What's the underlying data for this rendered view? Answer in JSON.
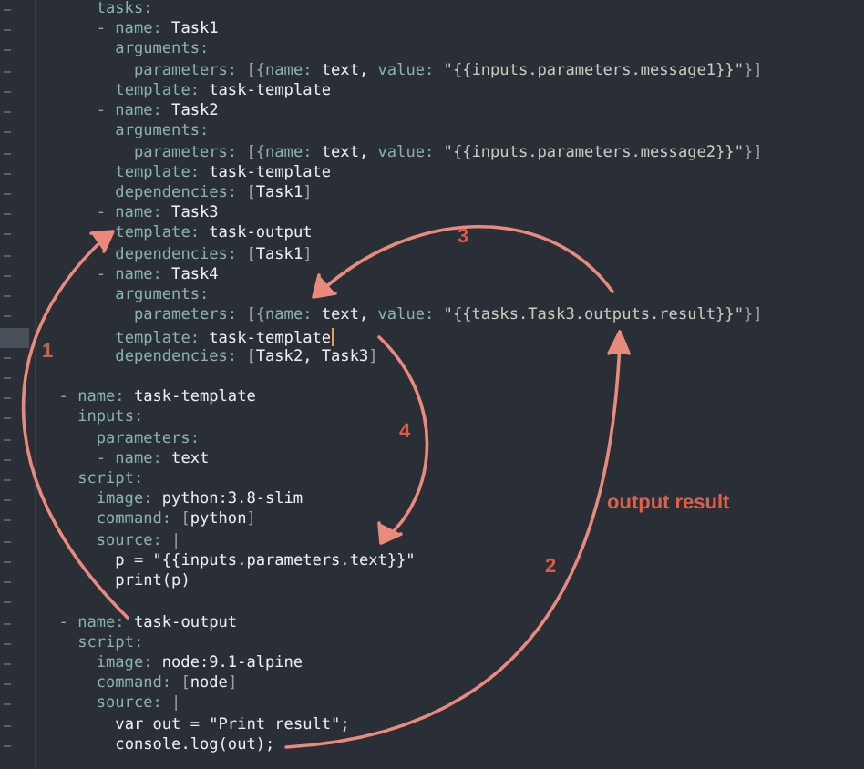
{
  "editor": {
    "lines": [
      {
        "current": false,
        "tokens": [
          {
            "kind": "key",
            "text": "      tasks:"
          }
        ]
      },
      {
        "current": false,
        "tokens": [
          {
            "kind": "key",
            "text": "      - name:"
          },
          {
            "kind": "val",
            "text": " Task1"
          }
        ]
      },
      {
        "current": false,
        "tokens": [
          {
            "kind": "key",
            "text": "        arguments:"
          }
        ]
      },
      {
        "current": false,
        "tokens": [
          {
            "kind": "key",
            "text": "          parameters:"
          },
          {
            "kind": "punct",
            "text": " [{"
          },
          {
            "kind": "key",
            "text": "name:"
          },
          {
            "kind": "val",
            "text": " text,"
          },
          {
            "kind": "key",
            "text": " value:"
          },
          {
            "kind": "str",
            "text": " \"{{inputs.parameters.message1}}\""
          },
          {
            "kind": "punct",
            "text": "}]"
          }
        ]
      },
      {
        "current": false,
        "tokens": [
          {
            "kind": "key",
            "text": "        template:"
          },
          {
            "kind": "val",
            "text": " task-template"
          }
        ]
      },
      {
        "current": false,
        "tokens": [
          {
            "kind": "key",
            "text": "      - name:"
          },
          {
            "kind": "val",
            "text": " Task2"
          }
        ]
      },
      {
        "current": false,
        "tokens": [
          {
            "kind": "key",
            "text": "        arguments:"
          }
        ]
      },
      {
        "current": false,
        "tokens": [
          {
            "kind": "key",
            "text": "          parameters:"
          },
          {
            "kind": "punct",
            "text": " [{"
          },
          {
            "kind": "key",
            "text": "name:"
          },
          {
            "kind": "val",
            "text": " text,"
          },
          {
            "kind": "key",
            "text": " value:"
          },
          {
            "kind": "str",
            "text": " \"{{inputs.parameters.message2}}\""
          },
          {
            "kind": "punct",
            "text": "}]"
          }
        ]
      },
      {
        "current": false,
        "tokens": [
          {
            "kind": "key",
            "text": "        template:"
          },
          {
            "kind": "val",
            "text": " task-template"
          }
        ]
      },
      {
        "current": false,
        "tokens": [
          {
            "kind": "key",
            "text": "        dependencies:"
          },
          {
            "kind": "punct",
            "text": " ["
          },
          {
            "kind": "val",
            "text": "Task1"
          },
          {
            "kind": "punct",
            "text": "]"
          }
        ]
      },
      {
        "current": false,
        "tokens": [
          {
            "kind": "key",
            "text": "      - name:"
          },
          {
            "kind": "val",
            "text": " Task3"
          }
        ]
      },
      {
        "current": false,
        "tokens": [
          {
            "kind": "key",
            "text": "        template:"
          },
          {
            "kind": "val",
            "text": " task-output"
          }
        ]
      },
      {
        "current": false,
        "tokens": [
          {
            "kind": "key",
            "text": "        dependencies:"
          },
          {
            "kind": "punct",
            "text": " ["
          },
          {
            "kind": "val",
            "text": "Task1"
          },
          {
            "kind": "punct",
            "text": "]"
          }
        ]
      },
      {
        "current": false,
        "tokens": [
          {
            "kind": "key",
            "text": "      - name:"
          },
          {
            "kind": "val",
            "text": " Task4"
          }
        ]
      },
      {
        "current": false,
        "tokens": [
          {
            "kind": "key",
            "text": "        arguments:"
          }
        ]
      },
      {
        "current": false,
        "tokens": [
          {
            "kind": "key",
            "text": "          parameters:"
          },
          {
            "kind": "punct",
            "text": " [{"
          },
          {
            "kind": "key",
            "text": "name:"
          },
          {
            "kind": "val",
            "text": " text,"
          },
          {
            "kind": "key",
            "text": " value:"
          },
          {
            "kind": "str",
            "text": " \"{{tasks.Task3.outputs.result}}\""
          },
          {
            "kind": "punct",
            "text": "}]"
          }
        ]
      },
      {
        "current": true,
        "tokens": [
          {
            "kind": "key",
            "text": "        template:"
          },
          {
            "kind": "val",
            "text": " task-template"
          }
        ]
      },
      {
        "current": false,
        "tokens": [
          {
            "kind": "key",
            "text": "        dependencies:"
          },
          {
            "kind": "punct",
            "text": " ["
          },
          {
            "kind": "val",
            "text": "Task2, Task3"
          },
          {
            "kind": "punct",
            "text": "]"
          }
        ]
      },
      {
        "current": false
      },
      {
        "current": false,
        "tokens": [
          {
            "kind": "key",
            "text": "  - name:"
          },
          {
            "kind": "val",
            "text": " task-template"
          }
        ]
      },
      {
        "current": false,
        "tokens": [
          {
            "kind": "key",
            "text": "    inputs:"
          }
        ]
      },
      {
        "current": false,
        "tokens": [
          {
            "kind": "key",
            "text": "      parameters:"
          }
        ]
      },
      {
        "current": false,
        "tokens": [
          {
            "kind": "key",
            "text": "      - name:"
          },
          {
            "kind": "val",
            "text": " text"
          }
        ]
      },
      {
        "current": false,
        "tokens": [
          {
            "kind": "key",
            "text": "    script:"
          }
        ]
      },
      {
        "current": false,
        "tokens": [
          {
            "kind": "key",
            "text": "      image:"
          },
          {
            "kind": "val",
            "text": " python:3.8-slim"
          }
        ]
      },
      {
        "current": false,
        "tokens": [
          {
            "kind": "key",
            "text": "      command:"
          },
          {
            "kind": "punct",
            "text": " ["
          },
          {
            "kind": "val",
            "text": "python"
          },
          {
            "kind": "punct",
            "text": "]"
          }
        ]
      },
      {
        "current": false,
        "tokens": [
          {
            "kind": "key",
            "text": "      source:"
          },
          {
            "kind": "punct",
            "text": " |"
          }
        ]
      },
      {
        "current": false,
        "tokens": [
          {
            "kind": "val",
            "text": "        p = \"{{inputs.parameters.text}}\""
          }
        ]
      },
      {
        "current": false,
        "tokens": [
          {
            "kind": "val",
            "text": "        print(p)"
          }
        ]
      },
      {
        "current": false
      },
      {
        "current": false,
        "tokens": [
          {
            "kind": "key",
            "text": "  - name:"
          },
          {
            "kind": "val",
            "text": " task-output"
          }
        ]
      },
      {
        "current": false,
        "tokens": [
          {
            "kind": "key",
            "text": "    script:"
          }
        ]
      },
      {
        "current": false,
        "tokens": [
          {
            "kind": "key",
            "text": "      image:"
          },
          {
            "kind": "val",
            "text": " node:9.1-alpine"
          }
        ]
      },
      {
        "current": false,
        "tokens": [
          {
            "kind": "key",
            "text": "      command:"
          },
          {
            "kind": "punct",
            "text": " ["
          },
          {
            "kind": "val",
            "text": "node"
          },
          {
            "kind": "punct",
            "text": "]"
          }
        ]
      },
      {
        "current": false,
        "tokens": [
          {
            "kind": "key",
            "text": "      source:"
          },
          {
            "kind": "punct",
            "text": " |"
          }
        ]
      },
      {
        "current": false,
        "tokens": [
          {
            "kind": "val",
            "text": "        var out = \"Print result\";"
          }
        ]
      },
      {
        "current": false,
        "tokens": [
          {
            "kind": "val",
            "text": "        console.log(out);"
          }
        ]
      }
    ]
  },
  "annotations": {
    "steps": [
      {
        "label": "1"
      },
      {
        "label": "2"
      },
      {
        "label": "3"
      },
      {
        "label": "4"
      }
    ],
    "note": "output result"
  }
}
